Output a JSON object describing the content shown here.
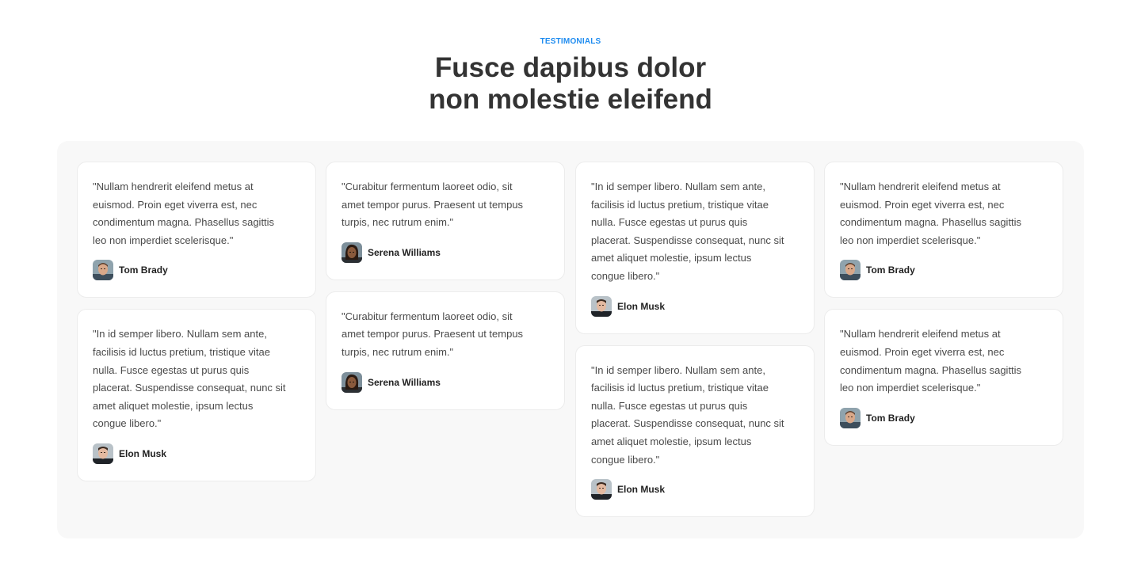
{
  "header": {
    "eyebrow": "TESTIMONIALS",
    "title_line1": "Fusce dapibus dolor",
    "title_line2": "non molestie eleifend"
  },
  "colors": {
    "accent": "#1f8cf0",
    "panel_bg": "#f8f8f8",
    "card_bg": "#ffffff",
    "title": "#333333"
  },
  "testimonials": [
    {
      "quote": "\"Nullam hendrerit eleifend metus at\neuismod. Proin eget viverra est, nec\ncondimentum magna. Phasellus sagittis\nleo non imperdiet scelerisque.\"",
      "author": "Tom Brady",
      "avatar_icon": "tom-brady-avatar"
    },
    {
      "quote": "\"In id semper libero. Nullam sem ante,\nfacilisis id luctus pretium, tristique vitae\nnulla. Fusce egestas ut purus quis\nplacerat. Suspendisse consequat, nunc sit\namet aliquet molestie, ipsum lectus\ncongue libero.\"",
      "author": "Elon Musk",
      "avatar_icon": "elon-musk-avatar"
    },
    {
      "quote": "\"Curabitur fermentum laoreet odio, sit\namet tempor purus. Praesent ut tempus\nturpis, nec rutrum enim.\"",
      "author": "Serena Williams",
      "avatar_icon": "serena-williams-avatar"
    },
    {
      "quote": "\"Curabitur fermentum laoreet odio, sit\namet tempor purus. Praesent ut tempus\nturpis, nec rutrum enim.\"",
      "author": "Serena Williams",
      "avatar_icon": "serena-williams-avatar"
    },
    {
      "quote": "\"In id semper libero. Nullam sem ante,\nfacilisis id luctus pretium, tristique vitae\nnulla. Fusce egestas ut purus quis\nplacerat. Suspendisse consequat, nunc sit\namet aliquet molestie, ipsum lectus\ncongue libero.\"",
      "author": "Elon Musk",
      "avatar_icon": "elon-musk-avatar"
    },
    {
      "quote": "\"In id semper libero. Nullam sem ante,\nfacilisis id luctus pretium, tristique vitae\nnulla. Fusce egestas ut purus quis\nplacerat. Suspendisse consequat, nunc sit\namet aliquet molestie, ipsum lectus\ncongue libero.\"",
      "author": "Elon Musk",
      "avatar_icon": "elon-musk-avatar"
    },
    {
      "quote": "\"Nullam hendrerit eleifend metus at\neuismod. Proin eget viverra est, nec\ncondimentum magna. Phasellus sagittis\nleo non imperdiet scelerisque.\"",
      "author": "Tom Brady",
      "avatar_icon": "tom-brady-avatar"
    },
    {
      "quote": "\"Nullam hendrerit eleifend metus at\neuismod. Proin eget viverra est, nec\ncondimentum magna. Phasellus sagittis\nleo non imperdiet scelerisque.\"",
      "author": "Tom Brady",
      "avatar_icon": "tom-brady-avatar"
    }
  ]
}
